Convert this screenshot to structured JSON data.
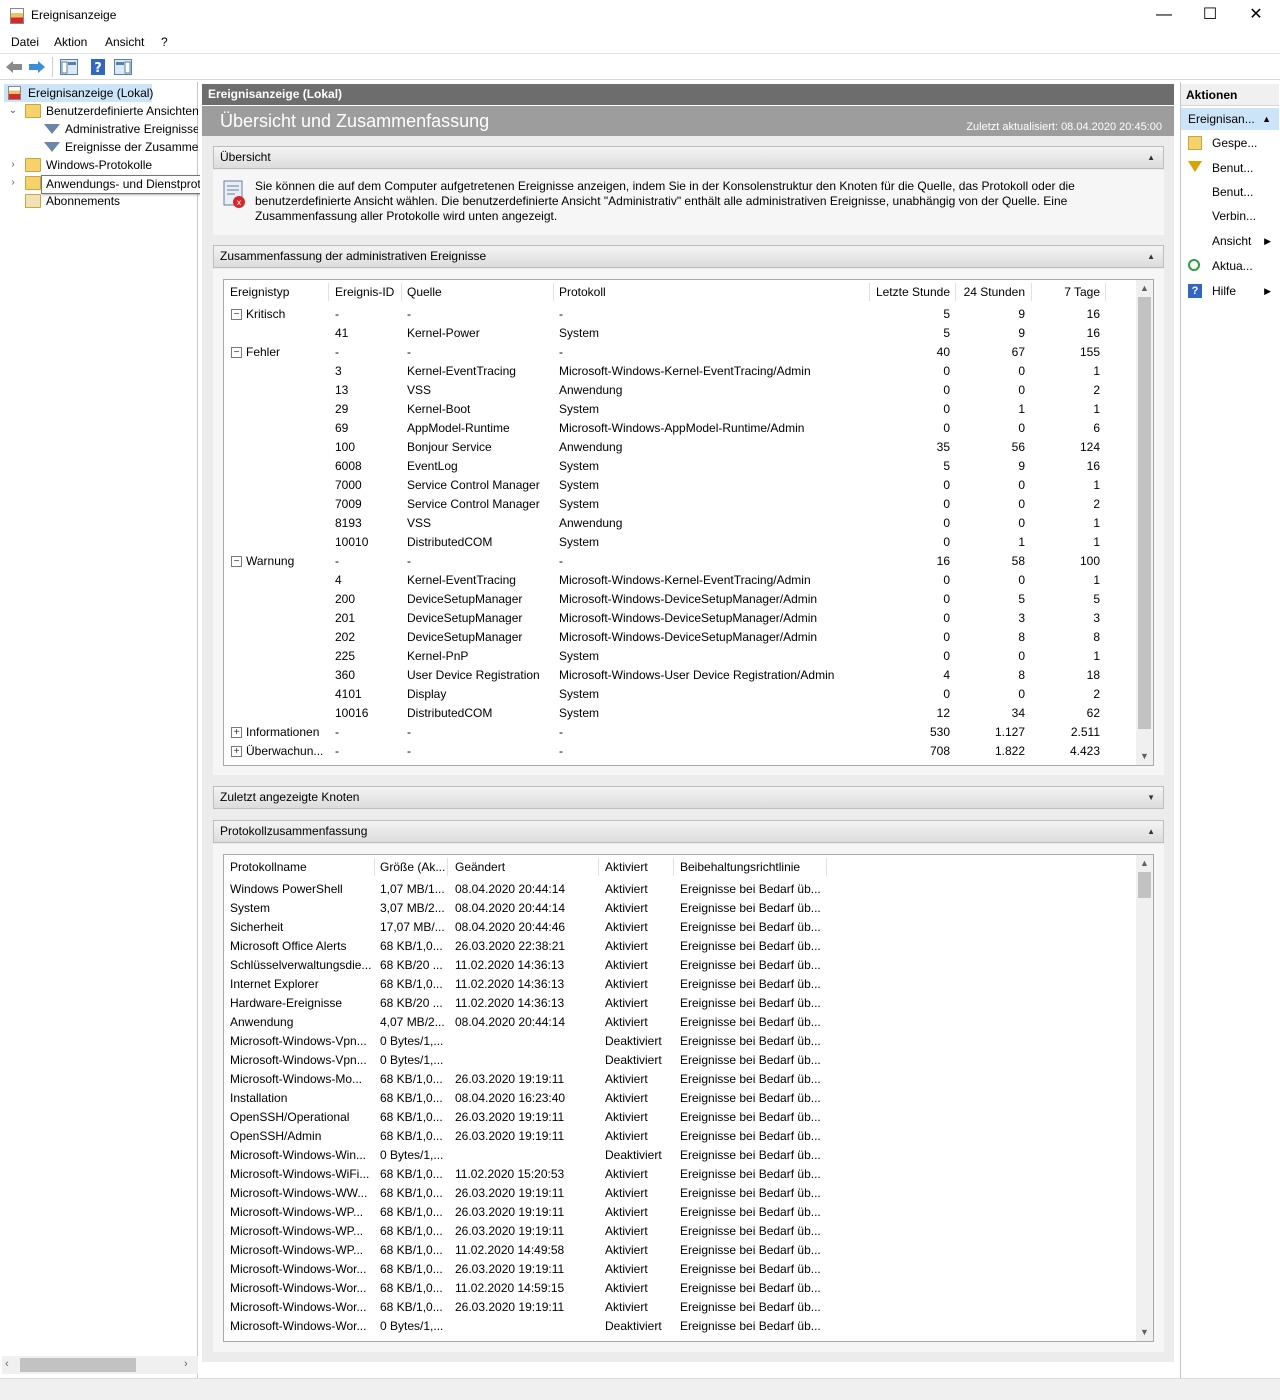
{
  "window": {
    "title": "Ereignisanzeige",
    "minimize": "—",
    "maximize": "☐",
    "close": "✕"
  },
  "menu": [
    "Datei",
    "Aktion",
    "Ansicht",
    "?"
  ],
  "tree": {
    "root": "Ereignisanzeige (Lokal)",
    "custom_views": "Benutzerdefinierte Ansichten",
    "admin_events": "Administrative Ereignisse",
    "summary_events": "Ereignisse der Zusammenfassung",
    "windows_logs": "Windows-Protokolle",
    "app_logs": "Anwendungs- und Dienstprotokolle",
    "subscriptions": "Abonnements",
    "tooltip": "Anwendungs- und Dienstprotokolle"
  },
  "center": {
    "header": "Ereignisanzeige (Lokal)",
    "title": "Übersicht und Zusammenfassung",
    "updated": "Zuletzt aktualisiert: 08.04.2020 20:45:00",
    "overview_title": "Übersicht",
    "overview_text": "Sie können die auf dem Computer aufgetretenen Ereignisse anzeigen, indem Sie in der Konsolenstruktur den Knoten für die Quelle, das Protokoll oder die benutzerdefinierte Ansicht wählen. Die benutzerdefinierte Ansicht \"Administrativ\" enthält alle administrativen Ereignisse, unabhängig von der Quelle. Eine Zusammenfassung aller Protokolle wird unten angezeigt.",
    "admin_summary_title": "Zusammenfassung der administrativen Ereignisse",
    "recent_nodes_title": "Zuletzt angezeigte Knoten",
    "log_summary_title": "Protokollzusammenfassung"
  },
  "events": {
    "columns": [
      "Ereignistyp",
      "Ereignis-ID",
      "Quelle",
      "Protokoll",
      "Letzte Stunde",
      "24 Stunden",
      "7 Tage"
    ],
    "rows": [
      {
        "type": "Kritisch",
        "exp": "−",
        "id": "-",
        "src": "-",
        "log": "-",
        "h": "5",
        "d": "9",
        "w": "16"
      },
      {
        "type": "",
        "exp": "",
        "id": "41",
        "src": "Kernel-Power",
        "log": "System",
        "h": "5",
        "d": "9",
        "w": "16"
      },
      {
        "type": "Fehler",
        "exp": "−",
        "id": "-",
        "src": "-",
        "log": "-",
        "h": "40",
        "d": "67",
        "w": "155"
      },
      {
        "type": "",
        "exp": "",
        "id": "3",
        "src": "Kernel-EventTracing",
        "log": "Microsoft-Windows-Kernel-EventTracing/Admin",
        "h": "0",
        "d": "0",
        "w": "1"
      },
      {
        "type": "",
        "exp": "",
        "id": "13",
        "src": "VSS",
        "log": "Anwendung",
        "h": "0",
        "d": "0",
        "w": "2"
      },
      {
        "type": "",
        "exp": "",
        "id": "29",
        "src": "Kernel-Boot",
        "log": "System",
        "h": "0",
        "d": "1",
        "w": "1"
      },
      {
        "type": "",
        "exp": "",
        "id": "69",
        "src": "AppModel-Runtime",
        "log": "Microsoft-Windows-AppModel-Runtime/Admin",
        "h": "0",
        "d": "0",
        "w": "6"
      },
      {
        "type": "",
        "exp": "",
        "id": "100",
        "src": "Bonjour Service",
        "log": "Anwendung",
        "h": "35",
        "d": "56",
        "w": "124"
      },
      {
        "type": "",
        "exp": "",
        "id": "6008",
        "src": "EventLog",
        "log": "System",
        "h": "5",
        "d": "9",
        "w": "16"
      },
      {
        "type": "",
        "exp": "",
        "id": "7000",
        "src": "Service Control Manager",
        "log": "System",
        "h": "0",
        "d": "0",
        "w": "1"
      },
      {
        "type": "",
        "exp": "",
        "id": "7009",
        "src": "Service Control Manager",
        "log": "System",
        "h": "0",
        "d": "0",
        "w": "2"
      },
      {
        "type": "",
        "exp": "",
        "id": "8193",
        "src": "VSS",
        "log": "Anwendung",
        "h": "0",
        "d": "0",
        "w": "1"
      },
      {
        "type": "",
        "exp": "",
        "id": "10010",
        "src": "DistributedCOM",
        "log": "System",
        "h": "0",
        "d": "1",
        "w": "1"
      },
      {
        "type": "Warnung",
        "exp": "−",
        "id": "-",
        "src": "-",
        "log": "-",
        "h": "16",
        "d": "58",
        "w": "100"
      },
      {
        "type": "",
        "exp": "",
        "id": "4",
        "src": "Kernel-EventTracing",
        "log": "Microsoft-Windows-Kernel-EventTracing/Admin",
        "h": "0",
        "d": "0",
        "w": "1"
      },
      {
        "type": "",
        "exp": "",
        "id": "200",
        "src": "DeviceSetupManager",
        "log": "Microsoft-Windows-DeviceSetupManager/Admin",
        "h": "0",
        "d": "5",
        "w": "5"
      },
      {
        "type": "",
        "exp": "",
        "id": "201",
        "src": "DeviceSetupManager",
        "log": "Microsoft-Windows-DeviceSetupManager/Admin",
        "h": "0",
        "d": "3",
        "w": "3"
      },
      {
        "type": "",
        "exp": "",
        "id": "202",
        "src": "DeviceSetupManager",
        "log": "Microsoft-Windows-DeviceSetupManager/Admin",
        "h": "0",
        "d": "8",
        "w": "8"
      },
      {
        "type": "",
        "exp": "",
        "id": "225",
        "src": "Kernel-PnP",
        "log": "System",
        "h": "0",
        "d": "0",
        "w": "1"
      },
      {
        "type": "",
        "exp": "",
        "id": "360",
        "src": "User Device Registration",
        "log": "Microsoft-Windows-User Device Registration/Admin",
        "h": "4",
        "d": "8",
        "w": "18"
      },
      {
        "type": "",
        "exp": "",
        "id": "4101",
        "src": "Display",
        "log": "System",
        "h": "0",
        "d": "0",
        "w": "2"
      },
      {
        "type": "",
        "exp": "",
        "id": "10016",
        "src": "DistributedCOM",
        "log": "System",
        "h": "12",
        "d": "34",
        "w": "62"
      },
      {
        "type": "Informationen",
        "exp": "+",
        "id": "-",
        "src": "-",
        "log": "-",
        "h": "530",
        "d": "1.127",
        "w": "2.511"
      },
      {
        "type": "Überwachun...",
        "exp": "+",
        "id": "-",
        "src": "-",
        "log": "-",
        "h": "708",
        "d": "1.822",
        "w": "4.423"
      }
    ]
  },
  "logs": {
    "columns": [
      "Protokollname",
      "Größe (Ak...",
      "Geändert",
      "Aktiviert",
      "Beibehaltungsrichtlinie"
    ],
    "rows": [
      {
        "name": "Windows PowerShell",
        "size": "1,07 MB/1...",
        "mod": "08.04.2020 20:44:14",
        "en": "Aktiviert",
        "ret": "Ereignisse bei Bedarf üb..."
      },
      {
        "name": "System",
        "size": "3,07 MB/2...",
        "mod": "08.04.2020 20:44:14",
        "en": "Aktiviert",
        "ret": "Ereignisse bei Bedarf üb..."
      },
      {
        "name": "Sicherheit",
        "size": "17,07 MB/...",
        "mod": "08.04.2020 20:44:46",
        "en": "Aktiviert",
        "ret": "Ereignisse bei Bedarf üb..."
      },
      {
        "name": "Microsoft Office Alerts",
        "size": "68 KB/1,0...",
        "mod": "26.03.2020 22:38:21",
        "en": "Aktiviert",
        "ret": "Ereignisse bei Bedarf üb..."
      },
      {
        "name": "Schlüsselverwaltungsdie...",
        "size": "68 KB/20 ...",
        "mod": "11.02.2020 14:36:13",
        "en": "Aktiviert",
        "ret": "Ereignisse bei Bedarf üb..."
      },
      {
        "name": "Internet Explorer",
        "size": "68 KB/1,0...",
        "mod": "11.02.2020 14:36:13",
        "en": "Aktiviert",
        "ret": "Ereignisse bei Bedarf üb..."
      },
      {
        "name": "Hardware-Ereignisse",
        "size": "68 KB/20 ...",
        "mod": "11.02.2020 14:36:13",
        "en": "Aktiviert",
        "ret": "Ereignisse bei Bedarf üb..."
      },
      {
        "name": "Anwendung",
        "size": "4,07 MB/2...",
        "mod": "08.04.2020 20:44:14",
        "en": "Aktiviert",
        "ret": "Ereignisse bei Bedarf üb..."
      },
      {
        "name": "Microsoft-Windows-Vpn...",
        "size": "0 Bytes/1,...",
        "mod": "",
        "en": "Deaktiviert",
        "ret": "Ereignisse bei Bedarf üb..."
      },
      {
        "name": "Microsoft-Windows-Vpn...",
        "size": "0 Bytes/1,...",
        "mod": "",
        "en": "Deaktiviert",
        "ret": "Ereignisse bei Bedarf üb..."
      },
      {
        "name": "Microsoft-Windows-Mo...",
        "size": "68 KB/1,0...",
        "mod": "26.03.2020 19:19:11",
        "en": "Aktiviert",
        "ret": "Ereignisse bei Bedarf üb..."
      },
      {
        "name": "Installation",
        "size": "68 KB/1,0...",
        "mod": "08.04.2020 16:23:40",
        "en": "Aktiviert",
        "ret": "Ereignisse bei Bedarf üb..."
      },
      {
        "name": "OpenSSH/Operational",
        "size": "68 KB/1,0...",
        "mod": "26.03.2020 19:19:11",
        "en": "Aktiviert",
        "ret": "Ereignisse bei Bedarf üb..."
      },
      {
        "name": "OpenSSH/Admin",
        "size": "68 KB/1,0...",
        "mod": "26.03.2020 19:19:11",
        "en": "Aktiviert",
        "ret": "Ereignisse bei Bedarf üb..."
      },
      {
        "name": "Microsoft-Windows-Win...",
        "size": "0 Bytes/1,...",
        "mod": "",
        "en": "Deaktiviert",
        "ret": "Ereignisse bei Bedarf üb..."
      },
      {
        "name": "Microsoft-Windows-WiFi...",
        "size": "68 KB/1,0...",
        "mod": "11.02.2020 15:20:53",
        "en": "Aktiviert",
        "ret": "Ereignisse bei Bedarf üb..."
      },
      {
        "name": "Microsoft-Windows-WW...",
        "size": "68 KB/1,0...",
        "mod": "26.03.2020 19:19:11",
        "en": "Aktiviert",
        "ret": "Ereignisse bei Bedarf üb..."
      },
      {
        "name": "Microsoft-Windows-WP...",
        "size": "68 KB/1,0...",
        "mod": "26.03.2020 19:19:11",
        "en": "Aktiviert",
        "ret": "Ereignisse bei Bedarf üb..."
      },
      {
        "name": "Microsoft-Windows-WP...",
        "size": "68 KB/1,0...",
        "mod": "26.03.2020 19:19:11",
        "en": "Aktiviert",
        "ret": "Ereignisse bei Bedarf üb..."
      },
      {
        "name": "Microsoft-Windows-WP...",
        "size": "68 KB/1,0...",
        "mod": "11.02.2020 14:49:58",
        "en": "Aktiviert",
        "ret": "Ereignisse bei Bedarf üb..."
      },
      {
        "name": "Microsoft-Windows-Wor...",
        "size": "68 KB/1,0...",
        "mod": "26.03.2020 19:19:11",
        "en": "Aktiviert",
        "ret": "Ereignisse bei Bedarf üb..."
      },
      {
        "name": "Microsoft-Windows-Wor...",
        "size": "68 KB/1,0...",
        "mod": "11.02.2020 14:59:15",
        "en": "Aktiviert",
        "ret": "Ereignisse bei Bedarf üb..."
      },
      {
        "name": "Microsoft-Windows-Wor...",
        "size": "68 KB/1,0...",
        "mod": "26.03.2020 19:19:11",
        "en": "Aktiviert",
        "ret": "Ereignisse bei Bedarf üb..."
      },
      {
        "name": "Microsoft-Windows-Wor...",
        "size": "0 Bytes/1,...",
        "mod": "",
        "en": "Deaktiviert",
        "ret": "Ereignisse bei Bedarf üb..."
      }
    ]
  },
  "actions": {
    "header": "Aktionen",
    "selected": "Ereignisan...",
    "items": [
      {
        "label": "Gespe...",
        "icon": "folder-open-icon",
        "submenu": false
      },
      {
        "label": "Benut...",
        "icon": "filter-icon",
        "submenu": false
      },
      {
        "label": "Benut...",
        "icon": "",
        "submenu": false
      },
      {
        "label": "Verbin...",
        "icon": "",
        "submenu": false
      },
      {
        "label": "Ansicht",
        "icon": "",
        "submenu": true
      },
      {
        "label": "Aktua...",
        "icon": "refresh-icon",
        "submenu": false
      },
      {
        "label": "Hilfe",
        "icon": "help-icon",
        "submenu": true
      }
    ]
  }
}
